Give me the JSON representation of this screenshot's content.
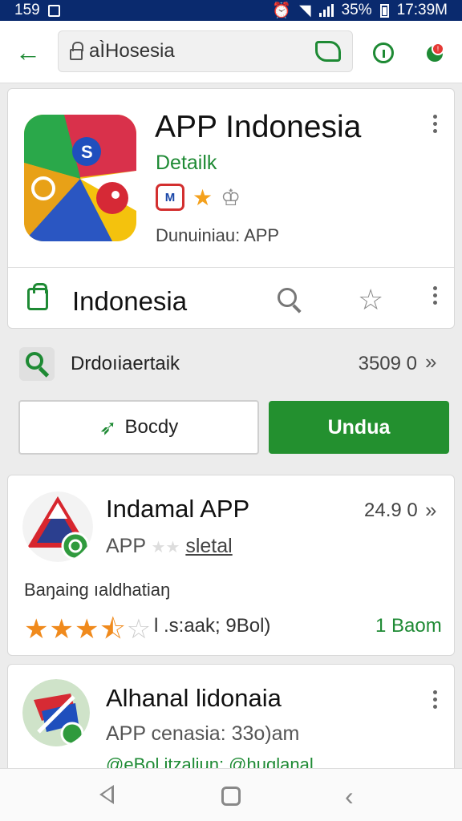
{
  "status_bar": {
    "left_text": "159",
    "battery": "35%",
    "time": "17:39M"
  },
  "app_bar": {
    "address": "aÌHosesia"
  },
  "header_card": {
    "title": "APP Indonesia",
    "subtitle": "Detailk",
    "badge_text": "M",
    "meta": "Dunuiniau: APP",
    "row_title": "Indonesia"
  },
  "summary": {
    "text": "Drdoıiaertaik",
    "count": "3509 0",
    "chevron": "»"
  },
  "buttons": {
    "secondary": "Bocdy",
    "primary": "Undua"
  },
  "list": [
    {
      "title": "Indamal APP",
      "count": "24.9 0",
      "sub_prefix": "APP",
      "sub_link": "sletal",
      "description": "Baŋaing ıaldhatiaŋ",
      "rating": 3.5,
      "rating_text": "l .s:aak; 9Bol)",
      "action": "1 Baom"
    },
    {
      "title": "Alhanal lidonaia",
      "sub": "APP cenasia: 33o)am",
      "footer": "@eBol.itzaliuŋ: @huglanal"
    }
  ],
  "colors": {
    "accent": "#1e8a34",
    "status_bar": "#0a2a6e",
    "star": "#f08a1c"
  }
}
